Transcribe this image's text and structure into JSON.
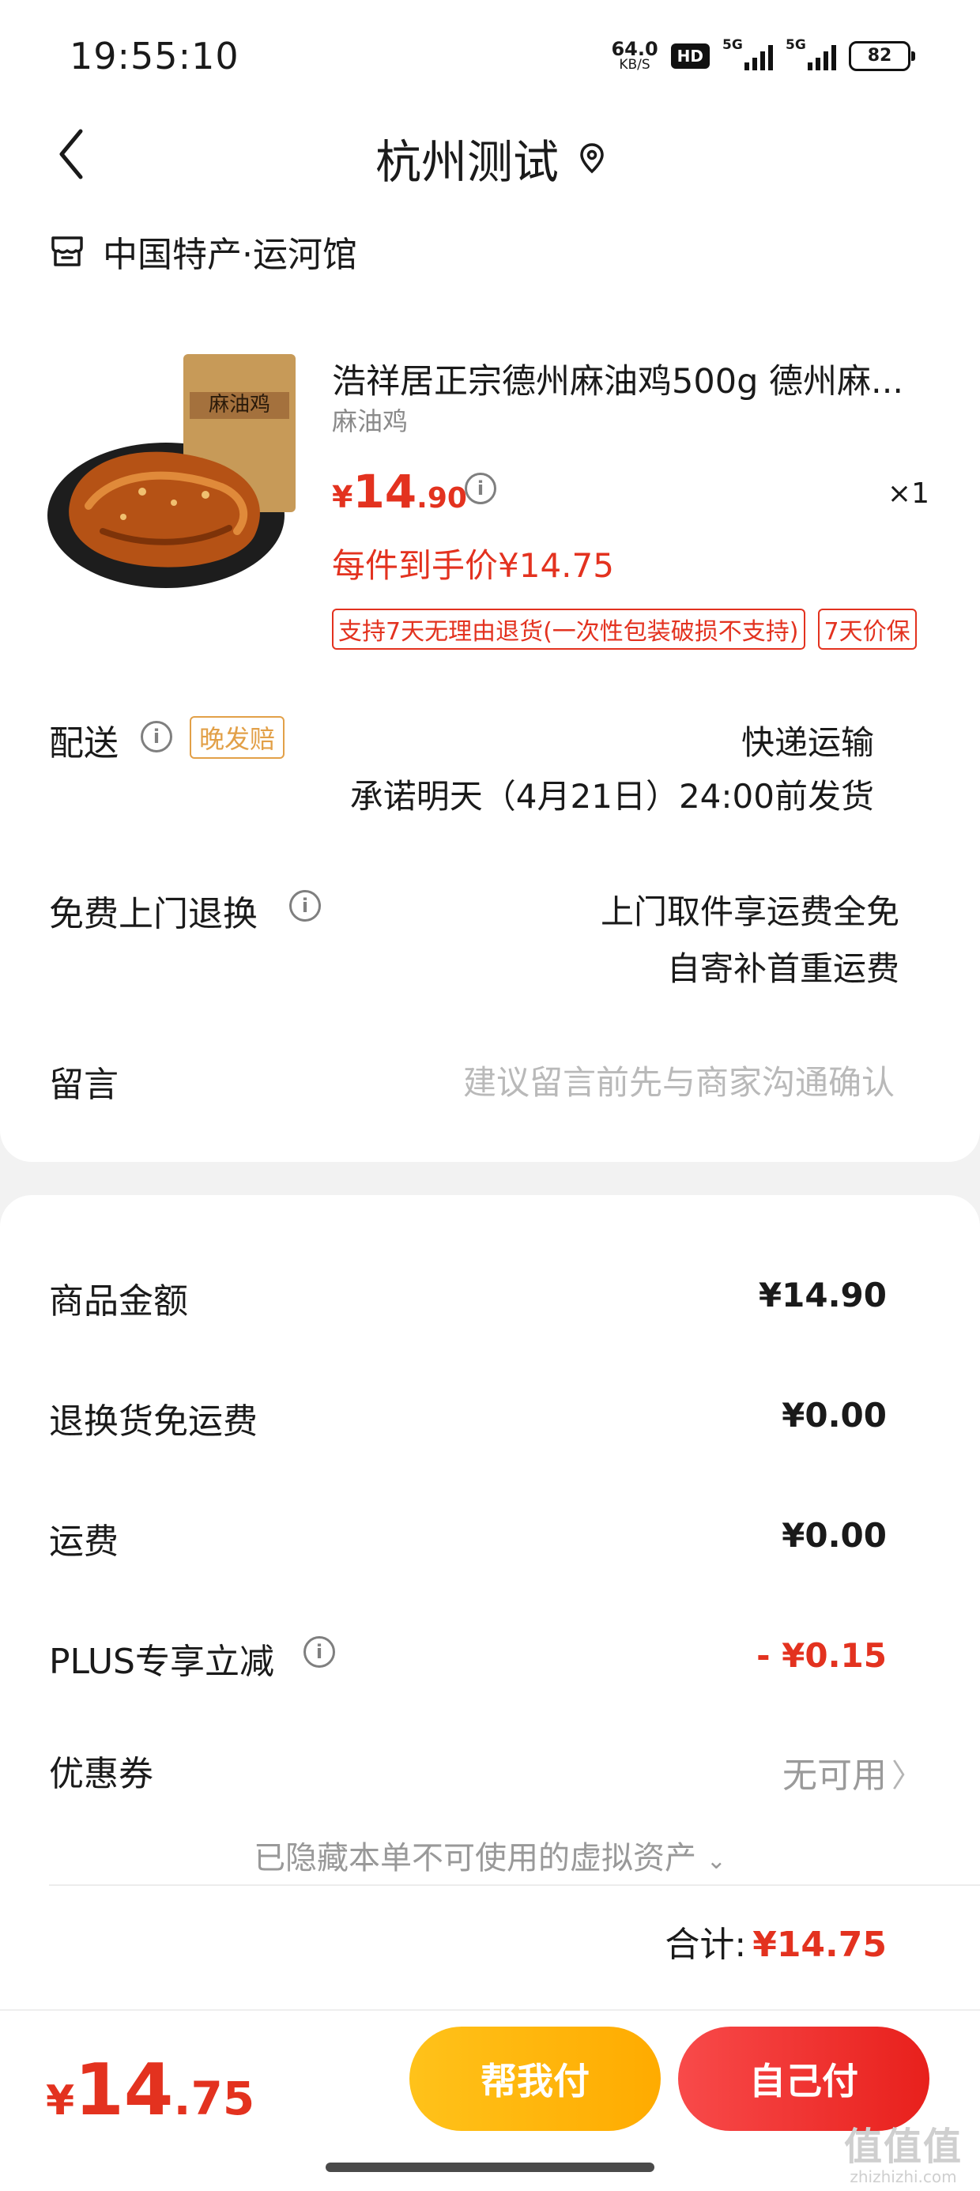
{
  "status_bar": {
    "time": "19:55:10",
    "net_speed_value": "64.0",
    "net_speed_unit": "KB/S",
    "hd_label": "HD",
    "signal1_label": "5G",
    "signal2_label": "5G",
    "battery": "82"
  },
  "header": {
    "title": "杭州测试",
    "back_icon": "chevron-left-icon",
    "location_icon": "location-pin-icon"
  },
  "store": {
    "icon": "store-icon",
    "name": "中国特产·运河馆"
  },
  "product": {
    "image_label": "麻油鸡",
    "title": "浩祥居正宗德州麻油鸡500g 德州麻...",
    "spec": "麻油鸡",
    "price_currency": "¥",
    "price_int": "14",
    "price_dec": ".90",
    "quantity": "×1",
    "unit_price": "每件到手价¥14.75",
    "tags": [
      "支持7天无理由退货(一次性包装破损不支持)",
      "7天价保"
    ]
  },
  "delivery": {
    "label": "配送",
    "badge": "晚发赔",
    "method": "快递运输",
    "promise": "承诺明天（4月21日）24:00前发货"
  },
  "returns": {
    "label": "免费上门退换",
    "line1": "上门取件享运费全免",
    "line2": "自寄补首重运费"
  },
  "message": {
    "label": "留言",
    "placeholder": "建议留言前先与商家沟通确认"
  },
  "summary": {
    "goods_label": "商品金额",
    "goods_value": "¥14.90",
    "return_ship_label": "退换货免运费",
    "return_ship_value": "¥0.00",
    "shipping_label": "运费",
    "shipping_value": "¥0.00",
    "plus_label": "PLUS专享立减",
    "plus_value": "- ¥0.15",
    "coupon_label": "优惠券",
    "coupon_value": "无可用",
    "hidden_note": "已隐藏本单不可使用的虚拟资产",
    "total_label": "合计:",
    "total_value": "¥14.75"
  },
  "bottom_bar": {
    "price_currency": "¥",
    "price_int": "14",
    "price_dec": ".75",
    "help_pay_label": "帮我付",
    "self_pay_label": "自己付"
  },
  "watermark": {
    "line1": "值值值",
    "line2": "zhizhizhi.com"
  },
  "colors": {
    "accent_red": "#e3321f",
    "help_button": "#ffb40a",
    "self_button": "#ee2a25",
    "late_badge": "#e2a048"
  }
}
